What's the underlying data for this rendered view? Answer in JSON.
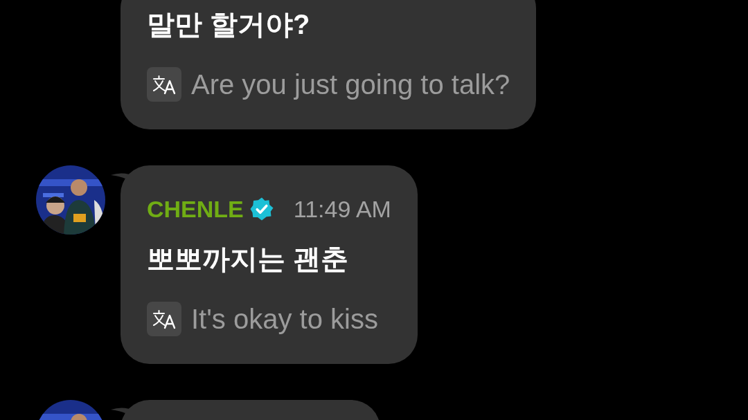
{
  "messages": [
    {
      "avatar": false,
      "text": "말만 할거야?",
      "translation": "Are you just going to talk?"
    },
    {
      "avatar": true,
      "sender": "CHENLE",
      "verified": true,
      "time": "11:49 AM",
      "text": "뽀뽀까지는 괜춘",
      "translation": "It's okay to kiss"
    },
    {
      "avatar": true
    }
  ]
}
